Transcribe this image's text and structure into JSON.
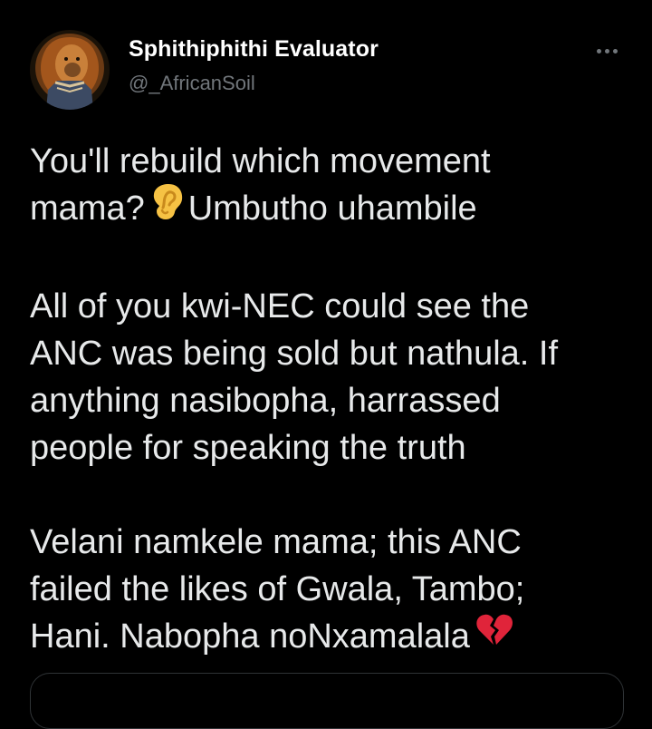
{
  "tweet": {
    "author": {
      "display_name": "Sphithiphithi Evaluator",
      "handle": "@_AfricanSoil",
      "avatar_icon": "lion-avatar-icon"
    },
    "more_icon": "more-horizontal-icon",
    "paragraphs": [
      {
        "lines": [
          {
            "text": "You'll rebuild which movement"
          },
          {
            "text_before": "mama?",
            "emoji": "ear-emoji",
            "text_after": "Umbutho uhambile"
          }
        ]
      },
      {
        "lines": [
          {
            "text": "All of you kwi-NEC could see the"
          },
          {
            "text": "ANC was being sold but nathula. If"
          },
          {
            "text": "anything nasibopha, harrassed"
          },
          {
            "text": "people for speaking the truth"
          }
        ]
      },
      {
        "lines": [
          {
            "text": "Velani namkele mama; this ANC"
          },
          {
            "text": "failed the likes of Gwala, Tambo;"
          },
          {
            "text_before": "Hani. Nabopha noNxamalala",
            "emoji": "broken-heart-emoji"
          }
        ]
      }
    ]
  },
  "colors": {
    "background": "#000000",
    "text_primary": "#e7e9ea",
    "text_secondary": "#71767b",
    "border": "#2f3336",
    "ear_emoji": "#f6c244",
    "broken_heart_emoji": "#e0243a"
  }
}
